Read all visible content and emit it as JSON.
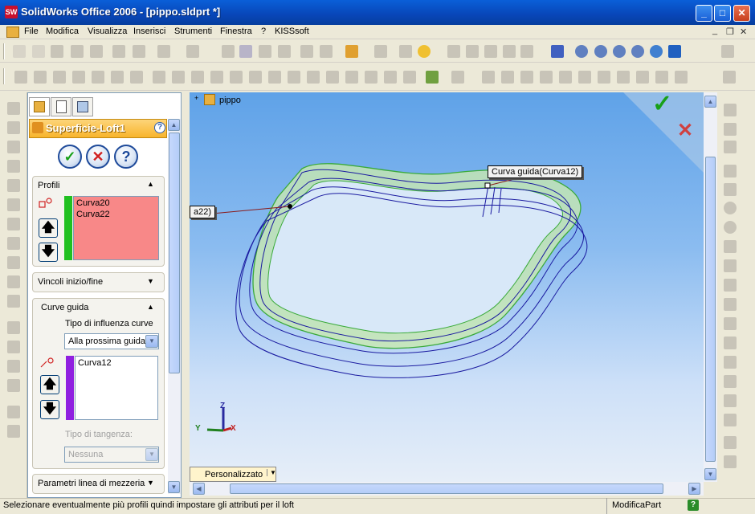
{
  "window": {
    "app_icon": "SW",
    "title": "SolidWorks Office 2006 - [pippo.sldprt *]",
    "minimize": "_",
    "maximize": "□",
    "close": "✕"
  },
  "menu": {
    "items": [
      "File",
      "Modifica",
      "Visualizza",
      "Inserisci",
      "Strumenti",
      "Finestra",
      "?",
      "KISSsoft"
    ],
    "mdi_minimize": "_",
    "mdi_restore": "❐",
    "mdi_close": "✕"
  },
  "tree": {
    "expander": "+",
    "root_label": "pippo"
  },
  "property_manager": {
    "title": "Superficie-Loft1",
    "ok_glyph": "✓",
    "cancel_glyph": "✕",
    "help_glyph": "?",
    "profiles": {
      "title": "Profili",
      "items": [
        "Curva20",
        "Curva22"
      ],
      "highlight_color": "#f88888",
      "bar_color": "#20c020"
    },
    "constraints": {
      "title": "Vincoli inizio/fine"
    },
    "guide_curves": {
      "title": "Curve guida",
      "influence_label": "Tipo di influenza curve",
      "influence_value": "Alla prossima guida",
      "items": [
        "Curva12"
      ],
      "bar_color": "#9020e0",
      "tangency_label": "Tipo di tangenza:",
      "tangency_value": "Nessuna"
    },
    "midline": {
      "title": "Parametri linea di mezzeria"
    },
    "move_up": "🡅",
    "move_down": "🡇"
  },
  "viewport": {
    "callout_guide": "Curva guida(Curva12)",
    "callout_profile": "a22)",
    "confirm_ok": "✓",
    "confirm_cancel": "✕",
    "view_combo": "Personalizzato",
    "axes": {
      "x": "X",
      "y": "Y",
      "z": "Z"
    }
  },
  "status": {
    "message": "Selezionare eventualmente più profili quindi impostare gli attributi per il loft",
    "mode": "ModificaPart",
    "help": "?"
  },
  "colors": {
    "title_bar": "#0846b8",
    "surface_fill": "#c8e8b0",
    "surface_edge": "#3aaa3a",
    "curve": "#1a1aa0"
  }
}
